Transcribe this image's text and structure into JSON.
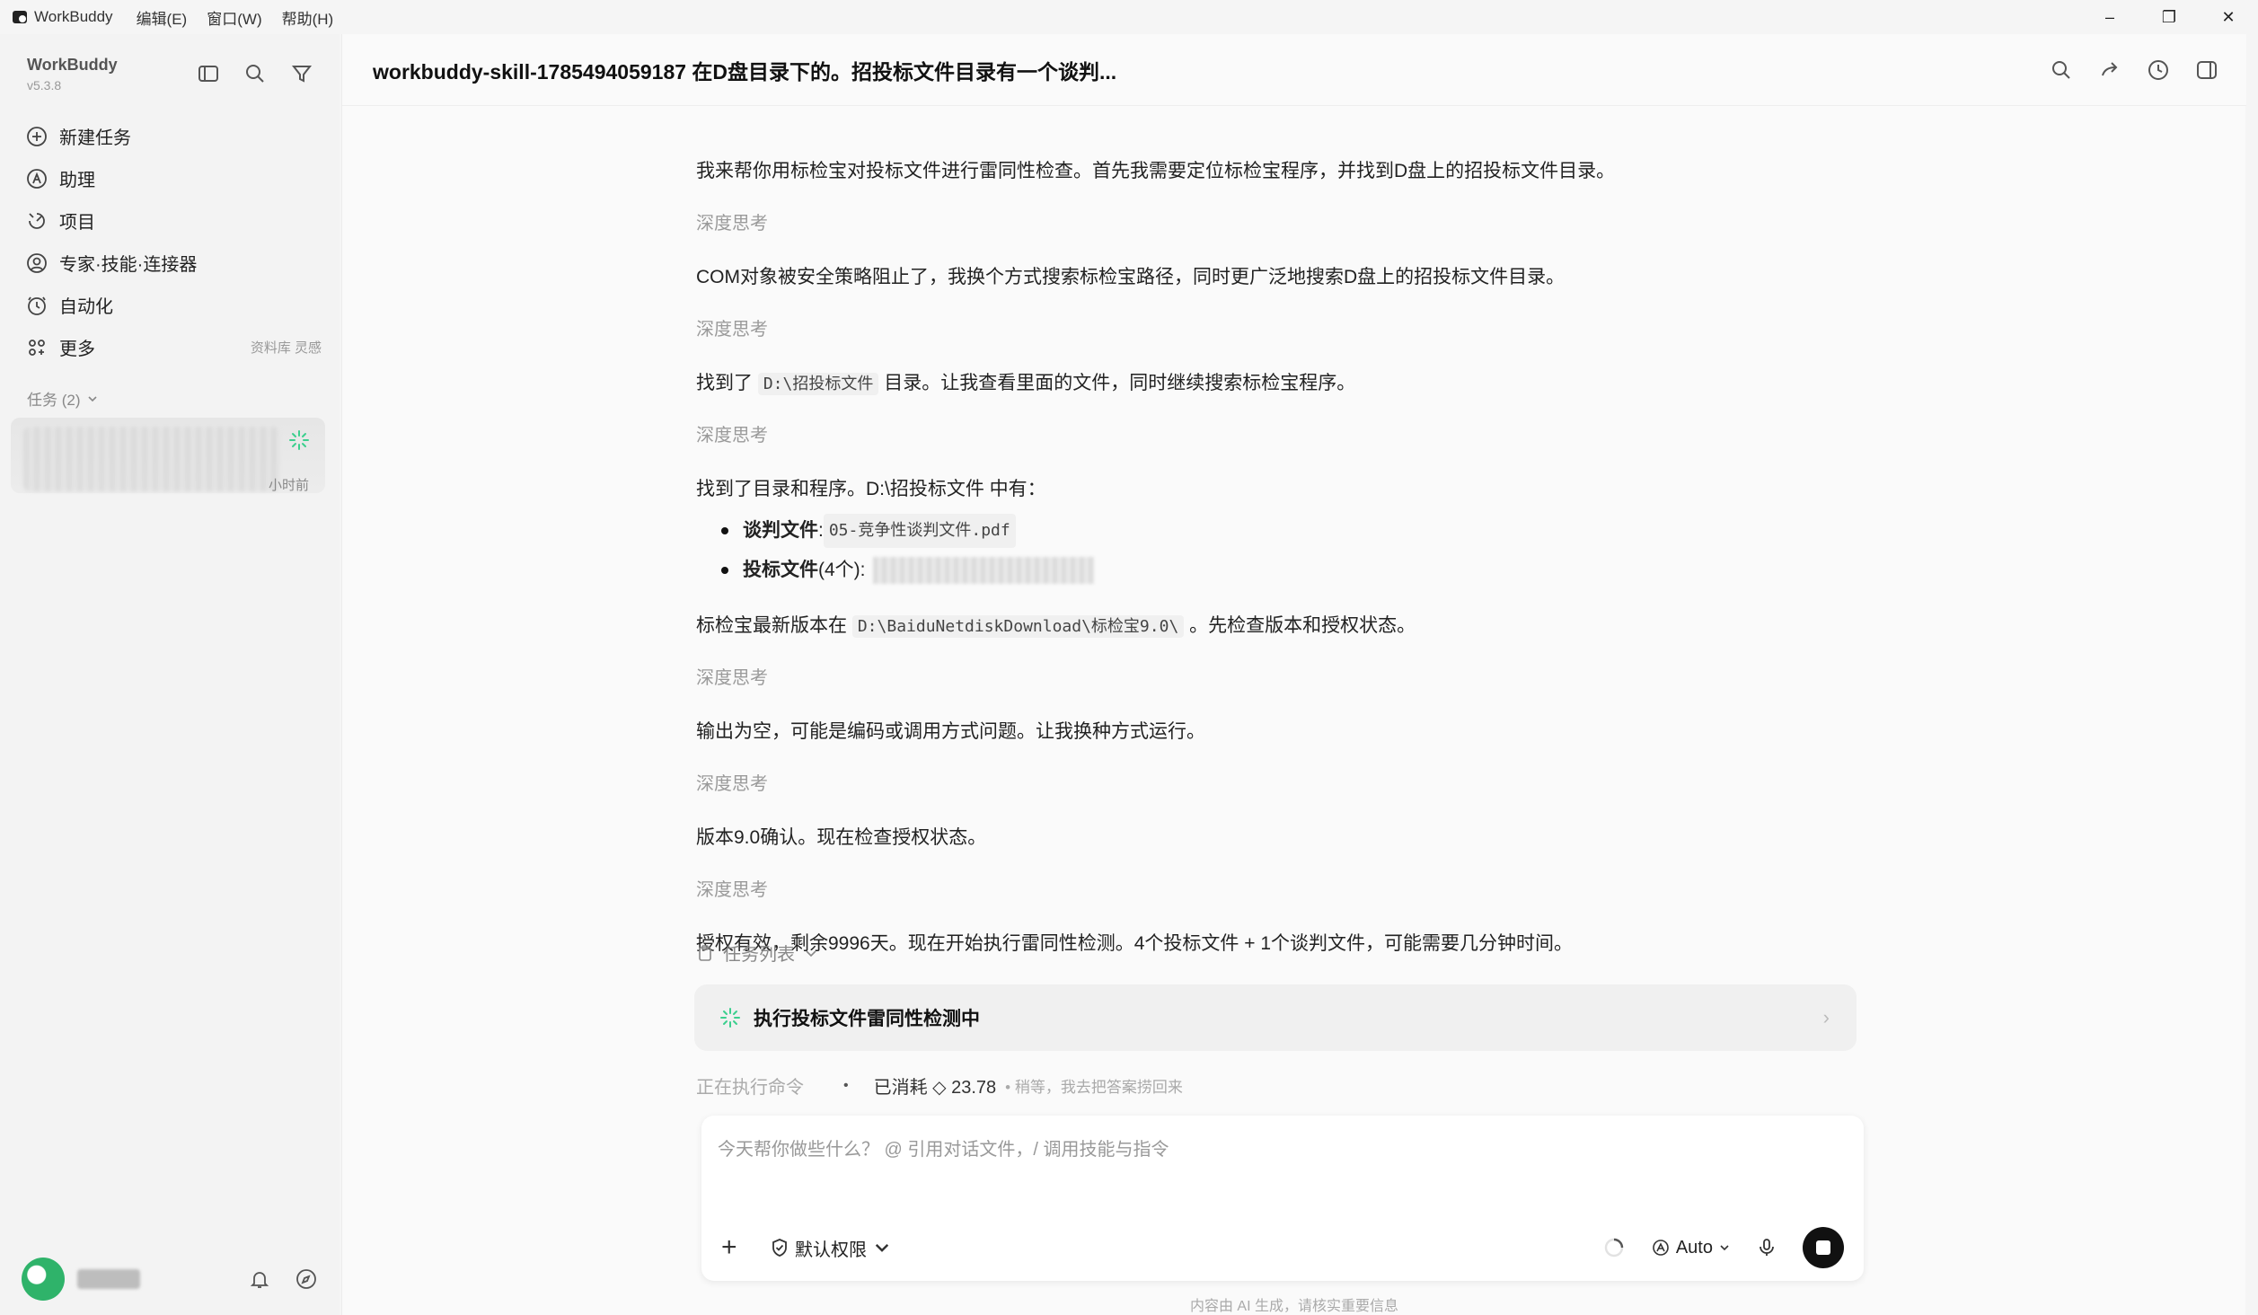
{
  "menubar": {
    "app_name": "WorkBuddy",
    "menus": [
      "编辑(E)",
      "窗口(W)",
      "帮助(H)"
    ],
    "minimize": "–",
    "restore": "❐",
    "close": "✕"
  },
  "sidebar": {
    "brand_name": "WorkBuddy",
    "brand_version": "v5.3.8",
    "nav": [
      {
        "label": "新建任务",
        "icon": "plus-circle-icon"
      },
      {
        "label": "助理",
        "icon": "assistant-icon"
      },
      {
        "label": "项目",
        "icon": "project-icon"
      },
      {
        "label": "专家·技能·连接器",
        "icon": "expert-icon"
      },
      {
        "label": "自动化",
        "icon": "automation-icon"
      },
      {
        "label": "更多",
        "icon": "more-grid-icon",
        "extra": "资料库 灵感"
      }
    ],
    "tasks_header": "任务 (2)",
    "task_time": "小时前"
  },
  "main": {
    "title": "workbuddy-skill-1785494059187 在D盘目录下的。招投标文件目录有一个谈判...",
    "thinking_label": "深度思考",
    "messages": {
      "m1": "我来帮你用标检宝对投标文件进行雷同性检查。首先我需要定位标检宝程序，并找到D盘上的招投标文件目录。",
      "m2": "COM对象被安全策略阻止了，我换个方式搜索标检宝路径，同时更广泛地搜索D盘上的招投标文件目录。",
      "m3_pre": "找到了",
      "m3_code": "D:\\招投标文件",
      "m3_post": "目录。让我查看里面的文件，同时继续搜索标检宝程序。",
      "m4": "找到了目录和程序。D:\\招投标文件 中有：",
      "b1_label": "谈判文件",
      "b1_sep": ": ",
      "b1_code": "05-竞争性谈判文件.pdf",
      "b2_label": "投标文件",
      "b2_count": " (4个):",
      "m5_pre": "标检宝最新版本在",
      "m5_code": "D:\\BaiduNetdiskDownload\\标检宝9.0\\",
      "m5_post": "。先检查版本和授权状态。",
      "m6": "输出为空，可能是编码或调用方式问题。让我换种方式运行。",
      "m7": "版本9.0确认。现在检查授权状态。",
      "m8": "授权有效，剩余9996天。现在开始执行雷同性检测。4个投标文件 + 1个谈判文件，可能需要几分钟时间。"
    },
    "tasklist_label": "任务列表",
    "task_exec_label": "执行投标文件雷同性检测中",
    "status_running": "正在执行命令",
    "status_cost": "已消耗 ◇ 23.78",
    "status_hint": "• 稍等，我去把答案捞回来",
    "input_placeholder": "今天帮你做些什么？ @ 引用对话文件，/ 调用技能与指令",
    "perm_label": "默认权限",
    "auto_label": "Auto",
    "disclaimer": "内容由 AI 生成，请核实重要信息"
  }
}
